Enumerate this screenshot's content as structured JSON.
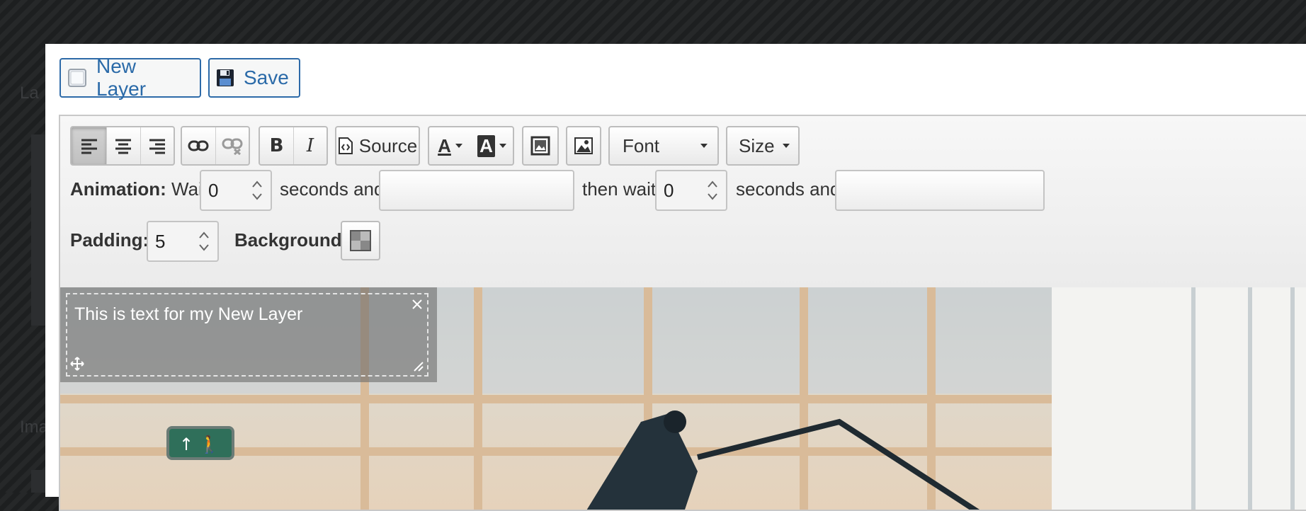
{
  "toolbar": {
    "new_layer_label": "New Layer",
    "save_label": "Save",
    "source_label": "Source",
    "font_label": "Font",
    "size_label": "Size"
  },
  "animation": {
    "label": "Animation:",
    "wait_label": "Wait",
    "wait_value": "0",
    "seconds_and_1": "seconds and",
    "then_wait_label": "then wait",
    "then_wait_value": "0",
    "seconds_and_2": "seconds and"
  },
  "padding": {
    "label": "Padding:",
    "value": "5"
  },
  "background": {
    "label": "Background:"
  },
  "layer": {
    "text": "This is text for my New Layer"
  },
  "colors": {
    "accent": "#2d6aa8",
    "overlay_backdrop": "#1d1f20",
    "panel": "#ffffff"
  }
}
